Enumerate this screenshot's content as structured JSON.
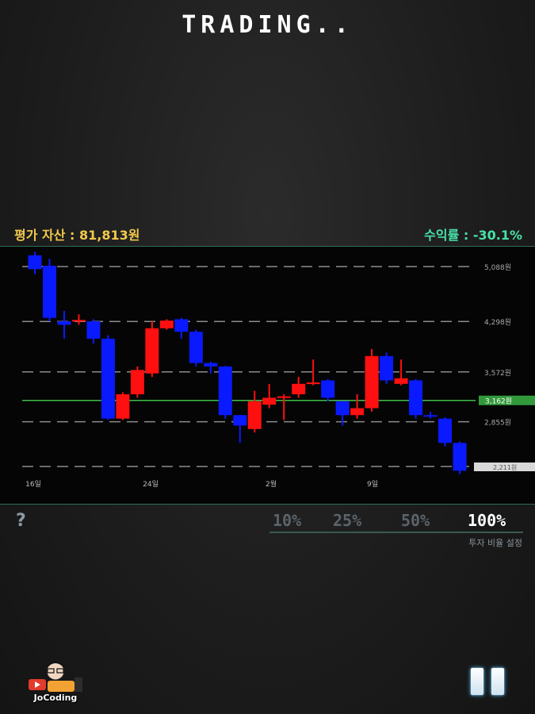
{
  "header": {
    "title": "TRADING.."
  },
  "stats": {
    "asset_label": "평가 자산 : 81,813원",
    "yield_label": "수익률 : -30.1%"
  },
  "chart_data": {
    "type": "candlestick",
    "y_ticks": [
      "5,088원",
      "4,298원",
      "3,572원",
      "2,855원"
    ],
    "current_price_label": "3,162원",
    "last_price_label": "2,211원",
    "x_ticks": [
      "16일",
      "24일",
      "2월",
      "9일"
    ],
    "candles": [
      {
        "o": 5250,
        "c": 5050,
        "h": 5300,
        "l": 4980
      },
      {
        "o": 5100,
        "c": 4350,
        "h": 5200,
        "l": 4300
      },
      {
        "o": 4300,
        "c": 4250,
        "h": 4450,
        "l": 4050
      },
      {
        "o": 4300,
        "c": 4320,
        "h": 4400,
        "l": 4250
      },
      {
        "o": 4300,
        "c": 4050,
        "h": 4330,
        "l": 3980
      },
      {
        "o": 4050,
        "c": 2900,
        "h": 4100,
        "l": 2880
      },
      {
        "o": 2900,
        "c": 3250,
        "h": 3280,
        "l": 2880
      },
      {
        "o": 3250,
        "c": 3600,
        "h": 3650,
        "l": 3200
      },
      {
        "o": 3550,
        "c": 4200,
        "h": 4300,
        "l": 3500
      },
      {
        "o": 4200,
        "c": 4310,
        "h": 4330,
        "l": 4180
      },
      {
        "o": 4330,
        "c": 4150,
        "h": 4350,
        "l": 4050
      },
      {
        "o": 4150,
        "c": 3700,
        "h": 4180,
        "l": 3650
      },
      {
        "o": 3700,
        "c": 3650,
        "h": 3720,
        "l": 3550
      },
      {
        "o": 3650,
        "c": 2950,
        "h": 3660,
        "l": 2900
      },
      {
        "o": 2950,
        "c": 2800,
        "h": 2950,
        "l": 2550
      },
      {
        "o": 2750,
        "c": 3150,
        "h": 3300,
        "l": 2700
      },
      {
        "o": 3100,
        "c": 3200,
        "h": 3400,
        "l": 3050
      },
      {
        "o": 3200,
        "c": 3220,
        "h": 3250,
        "l": 2880
      },
      {
        "o": 3250,
        "c": 3400,
        "h": 3500,
        "l": 3200
      },
      {
        "o": 3400,
        "c": 3420,
        "h": 3750,
        "l": 3380
      },
      {
        "o": 3450,
        "c": 3200,
        "h": 3470,
        "l": 3150
      },
      {
        "o": 3150,
        "c": 2950,
        "h": 3150,
        "l": 2800
      },
      {
        "o": 2950,
        "c": 3050,
        "h": 3250,
        "l": 2900
      },
      {
        "o": 3050,
        "c": 3800,
        "h": 3900,
        "l": 3000
      },
      {
        "o": 3800,
        "c": 3450,
        "h": 3850,
        "l": 3400
      },
      {
        "o": 3400,
        "c": 3480,
        "h": 3750,
        "l": 3380
      },
      {
        "o": 3450,
        "c": 2950,
        "h": 3470,
        "l": 2900
      },
      {
        "o": 2950,
        "c": 2930,
        "h": 3000,
        "l": 2900
      },
      {
        "o": 2900,
        "c": 2550,
        "h": 2920,
        "l": 2500
      },
      {
        "o": 2550,
        "c": 2150,
        "h": 2570,
        "l": 2100
      }
    ],
    "grid": true,
    "colors": {
      "up": "#ff1010",
      "down": "#0a1aff",
      "current_line": "#3fbf4a"
    }
  },
  "controls": {
    "help_label": "?",
    "ratios": [
      "10%",
      "25%",
      "50%",
      "100%"
    ],
    "active_ratio": "100%",
    "ratio_caption": "투자 비율 설정"
  },
  "branding": {
    "logo_text": "JoCoding"
  },
  "icons": {
    "help": "question-icon",
    "pause": "pause-icon"
  }
}
